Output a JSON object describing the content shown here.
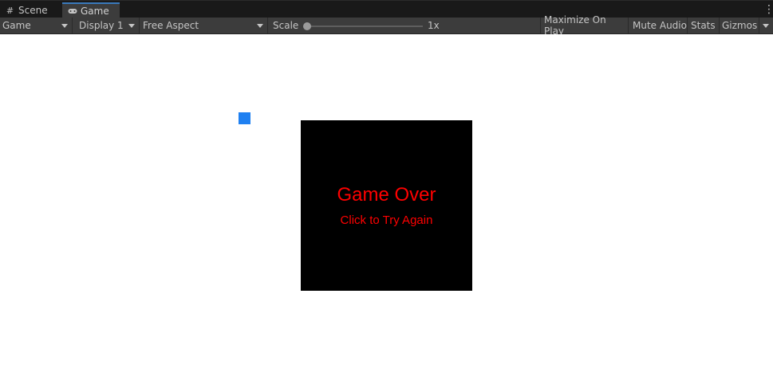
{
  "tabs": [
    {
      "label": "Scene",
      "icon": "grid-icon"
    },
    {
      "label": "Game",
      "icon": "gamepad-icon",
      "active": true
    }
  ],
  "toolbar": {
    "mode": "Game",
    "display": "Display 1",
    "aspect": "Free Aspect",
    "scale_label": "Scale",
    "scale_value": "1x",
    "maximize": "Maximize On Play",
    "mute": "Mute Audio",
    "stats": "Stats",
    "gizmos": "Gizmos"
  },
  "game": {
    "title": "Game Over",
    "subtitle": "Click to Try Again"
  },
  "colors": {
    "player": "#1f80f1",
    "game_over_text": "#ff0000",
    "panel": "#000000"
  }
}
